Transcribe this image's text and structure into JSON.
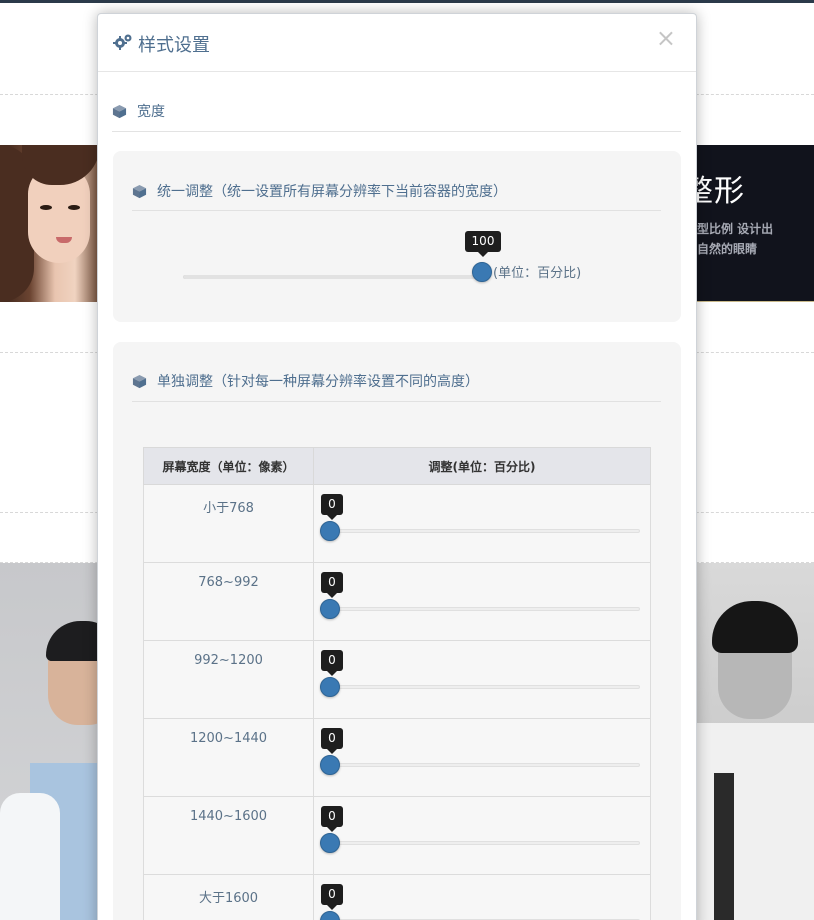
{
  "background": {
    "banner_title": "整形",
    "banner_line_1": "型比例  设计出",
    "banner_line_2": "自然的眼睛"
  },
  "modal": {
    "title": "样式设置",
    "close_glyph": "×",
    "section_title": "宽度",
    "unified": {
      "heading": "统一调整（统一设置所有屏幕分辨率下当前容器的宽度）",
      "value": "100",
      "unit_label": "(单位：百分比)"
    },
    "individual": {
      "heading": "单独调整（针对每一种屏幕分辨率设置不同的高度）",
      "columns": [
        "屏幕宽度（单位：像素）",
        "调整(单位：百分比)"
      ],
      "rows": [
        {
          "resolution": "小于768",
          "value": "0"
        },
        {
          "resolution": "768~992",
          "value": "0"
        },
        {
          "resolution": "992~1200",
          "value": "0"
        },
        {
          "resolution": "1200~1440",
          "value": "0"
        },
        {
          "resolution": "1440~1600",
          "value": "0"
        },
        {
          "resolution": "大于1600",
          "value": "0"
        }
      ]
    }
  },
  "colors": {
    "accent": "#3a79b3",
    "heading_text": "#4f6f8f",
    "tooltip_bg": "#1e1e1e"
  },
  "icons": [
    "gears-icon",
    "cube-icon",
    "close-icon"
  ]
}
